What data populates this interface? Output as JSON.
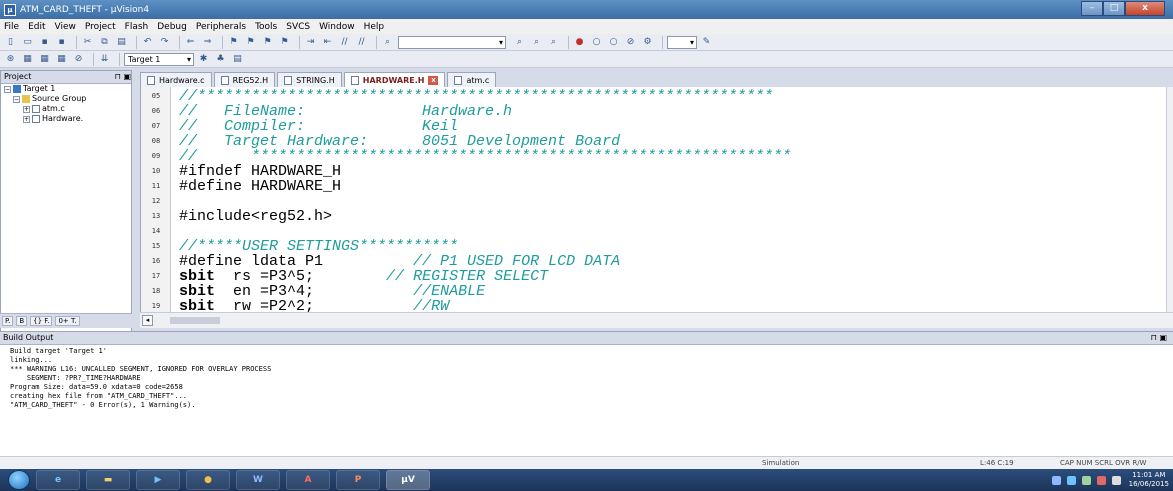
{
  "window": {
    "title": "ATM_CARD_THEFT - µVision4"
  },
  "menu": [
    "File",
    "Edit",
    "View",
    "Project",
    "Flash",
    "Debug",
    "Peripherals",
    "Tools",
    "SVCS",
    "Window",
    "Help"
  ],
  "toolbar": {
    "target_select": "Target 1",
    "find_combo": ""
  },
  "project_panel": {
    "title": "Project",
    "tree": [
      "Target 1",
      "Source Group",
      "atm.c",
      "Hardware."
    ],
    "bottom_tabs": [
      "P.",
      "B",
      "{} F.",
      "0+ T."
    ]
  },
  "editor": {
    "tabs": [
      {
        "label": "Hardware.c",
        "active": false
      },
      {
        "label": "REG52.H",
        "active": false
      },
      {
        "label": "STRING.H",
        "active": false
      },
      {
        "label": "HARDWARE.H",
        "active": true
      },
      {
        "label": "atm.c",
        "active": false
      }
    ],
    "lines": [
      {
        "num": "05",
        "parts": [
          {
            "t": "//****************************************************************",
            "c": "cmt"
          }
        ]
      },
      {
        "num": "06",
        "parts": [
          {
            "t": "//   FileName:             Hardware.h",
            "c": "cmt"
          }
        ]
      },
      {
        "num": "07",
        "parts": [
          {
            "t": "//   Compiler:             Keil",
            "c": "cmt"
          }
        ]
      },
      {
        "num": "08",
        "parts": [
          {
            "t": "//   Target Hardware:      8051 Development Board",
            "c": "cmt"
          }
        ]
      },
      {
        "num": "09",
        "parts": [
          {
            "t": "//      ************************************************************",
            "c": "cmt"
          }
        ]
      },
      {
        "num": "10",
        "parts": [
          {
            "t": "#ifndef HARDWARE_H",
            "c": ""
          }
        ]
      },
      {
        "num": "11",
        "parts": [
          {
            "t": "#define HARDWARE_H",
            "c": ""
          }
        ]
      },
      {
        "num": "12",
        "parts": [
          {
            "t": "",
            "c": ""
          }
        ]
      },
      {
        "num": "13",
        "parts": [
          {
            "t": "#include<reg52.h>",
            "c": ""
          }
        ]
      },
      {
        "num": "14",
        "parts": [
          {
            "t": "",
            "c": ""
          }
        ]
      },
      {
        "num": "15",
        "parts": [
          {
            "t": "//*****USER SETTINGS***********",
            "c": "cmt"
          }
        ]
      },
      {
        "num": "16",
        "parts": [
          {
            "t": "#define ldata P1",
            "c": ""
          },
          {
            "t": "          // P1 USED FOR LCD DATA",
            "c": "cmt"
          }
        ]
      },
      {
        "num": "17",
        "parts": [
          {
            "t": "sbit",
            "c": "kw"
          },
          {
            "t": "  rs =P3^5;",
            "c": ""
          },
          {
            "t": "        // REGISTER SELECT",
            "c": "cmt"
          }
        ]
      },
      {
        "num": "18",
        "parts": [
          {
            "t": "sbit",
            "c": "kw"
          },
          {
            "t": "  en =P3^4;",
            "c": ""
          },
          {
            "t": "           //ENABLE",
            "c": "cmt"
          }
        ]
      },
      {
        "num": "19",
        "parts": [
          {
            "t": "sbit",
            "c": "kw"
          },
          {
            "t": "  rw =P2^2;",
            "c": ""
          },
          {
            "t": "           //RW",
            "c": "cmt"
          }
        ]
      }
    ]
  },
  "build_output": {
    "title": "Build Output",
    "lines": [
      "Build target 'Target 1'",
      "linking...",
      "*** WARNING L16: UNCALLED SEGMENT, IGNORED FOR OVERLAY PROCESS",
      "    SEGMENT: ?PR?_TIME?HARDWARE",
      "Program Size: data=59.0 xdata=0 code=2658",
      "creating hex file from \"ATM_CARD_THEFT\"...",
      "\"ATM_CARD_THEFT\" - 0 Error(s), 1 Warning(s)."
    ]
  },
  "statusbar": {
    "mode": "Simulation",
    "position": "L:46 C:19",
    "indicators": "CAP  NUM  SCRL  OVR  R/W"
  },
  "taskbar": {
    "time": "11:01 AM",
    "date": "16/06/2015"
  }
}
